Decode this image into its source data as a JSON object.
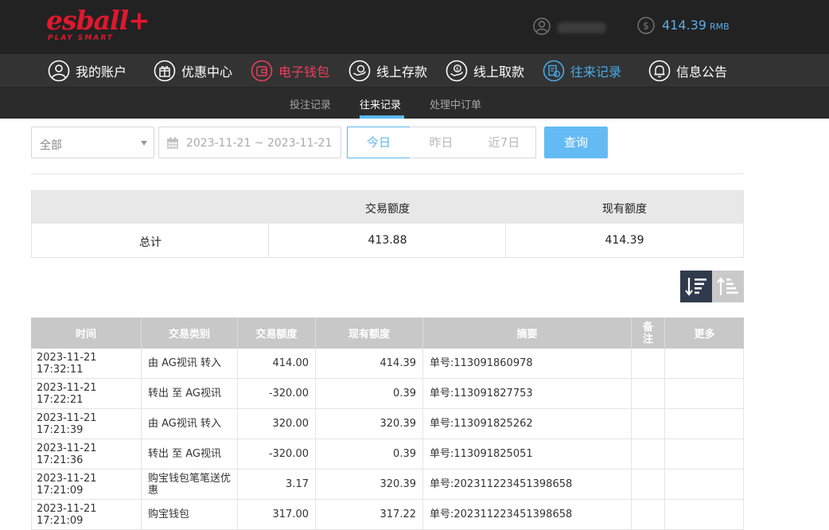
{
  "header": {
    "logo": "esball+",
    "logo_sub": "PLAY SMART",
    "balance": "414.39",
    "currency": "RMB"
  },
  "nav": [
    {
      "label": "我的账户",
      "icon": "user-icon"
    },
    {
      "label": "优惠中心",
      "icon": "gift-icon"
    },
    {
      "label": "电子钱包",
      "icon": "wallet-icon"
    },
    {
      "label": "线上存款",
      "icon": "deposit-icon"
    },
    {
      "label": "线上取款",
      "icon": "withdraw-icon"
    },
    {
      "label": "往来记录",
      "icon": "records-icon"
    },
    {
      "label": "信息公告",
      "icon": "bell-icon"
    }
  ],
  "subnav": [
    "投注记录",
    "往来记录",
    "处理中订单"
  ],
  "filters": {
    "type_selected": "全部",
    "date_range": "2023-11-21 ~ 2023-11-21",
    "today": "今日",
    "yesterday": "昨日",
    "last7": "近7日",
    "query": "查询"
  },
  "summary": {
    "col_trade": "交易额度",
    "col_current": "现有额度",
    "row_label": "总计",
    "trade_total": "413.88",
    "current_total": "414.39"
  },
  "table": {
    "headers": [
      "时间",
      "交易类别",
      "交易额度",
      "现有额度",
      "摘要",
      "备注",
      "更多"
    ],
    "rows": [
      {
        "time": "2023-11-21 17:32:11",
        "type": "由 AG视讯 转入",
        "amount": "414.00",
        "balance": "414.39",
        "summary": "单号:113091860978"
      },
      {
        "time": "2023-11-21 17:22:21",
        "type": "转出 至 AG视讯",
        "amount": "-320.00",
        "balance": "0.39",
        "summary": "单号:113091827753"
      },
      {
        "time": "2023-11-21 17:21:39",
        "type": "由 AG视讯 转入",
        "amount": "320.00",
        "balance": "320.39",
        "summary": "单号:113091825262"
      },
      {
        "time": "2023-11-21 17:21:36",
        "type": "转出 至 AG视讯",
        "amount": "-320.00",
        "balance": "0.39",
        "summary": "单号:113091825051"
      },
      {
        "time": "2023-11-21 17:21:09",
        "type": "购宝钱包笔笔送优惠",
        "amount": "3.17",
        "balance": "320.39",
        "summary": "单号:202311223451398658"
      },
      {
        "time": "2023-11-21 17:21:09",
        "type": "购宝钱包",
        "amount": "317.00",
        "balance": "317.22",
        "summary": "单号:202311223451398658"
      }
    ]
  },
  "colors": {
    "header_bg": "#222222",
    "nav_bg": "#333333",
    "accent_blue": "#5cb8f0",
    "accent_red": "#e8405a",
    "logo_red": "#e0182d"
  }
}
